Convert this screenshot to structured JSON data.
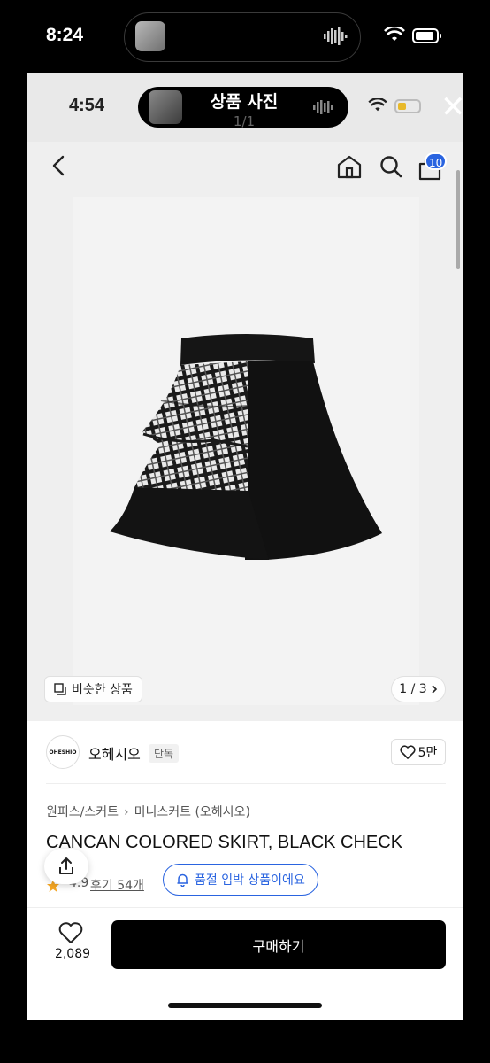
{
  "outer_status": {
    "time": "8:24"
  },
  "inner_status": {
    "time": "4:54",
    "island_title": "상품 사진",
    "counter": "1/1"
  },
  "header": {
    "cart_count": "10"
  },
  "gallery": {
    "similar_label": "비슷한 상품",
    "pager": "1 / 3"
  },
  "brand": {
    "logo_text": "OHESHIO",
    "name": "오헤시오",
    "tag": "단독",
    "likes": "5만"
  },
  "breadcrumb": {
    "category": "원피스/스커트",
    "subcategory": "미니스커트 (오헤시오)"
  },
  "product": {
    "title": "CANCAN COLORED SKIRT, BLACK CHECK",
    "rating": "4.9",
    "review_label": "후기 54개",
    "stock_notice": "품절 임박 상품이에요"
  },
  "bottom": {
    "wish_count": "2,089",
    "buy_label": "구매하기"
  },
  "colors": {
    "accent": "#2a64e0",
    "buy_button": "#000000",
    "badge": "#2a64e0"
  }
}
